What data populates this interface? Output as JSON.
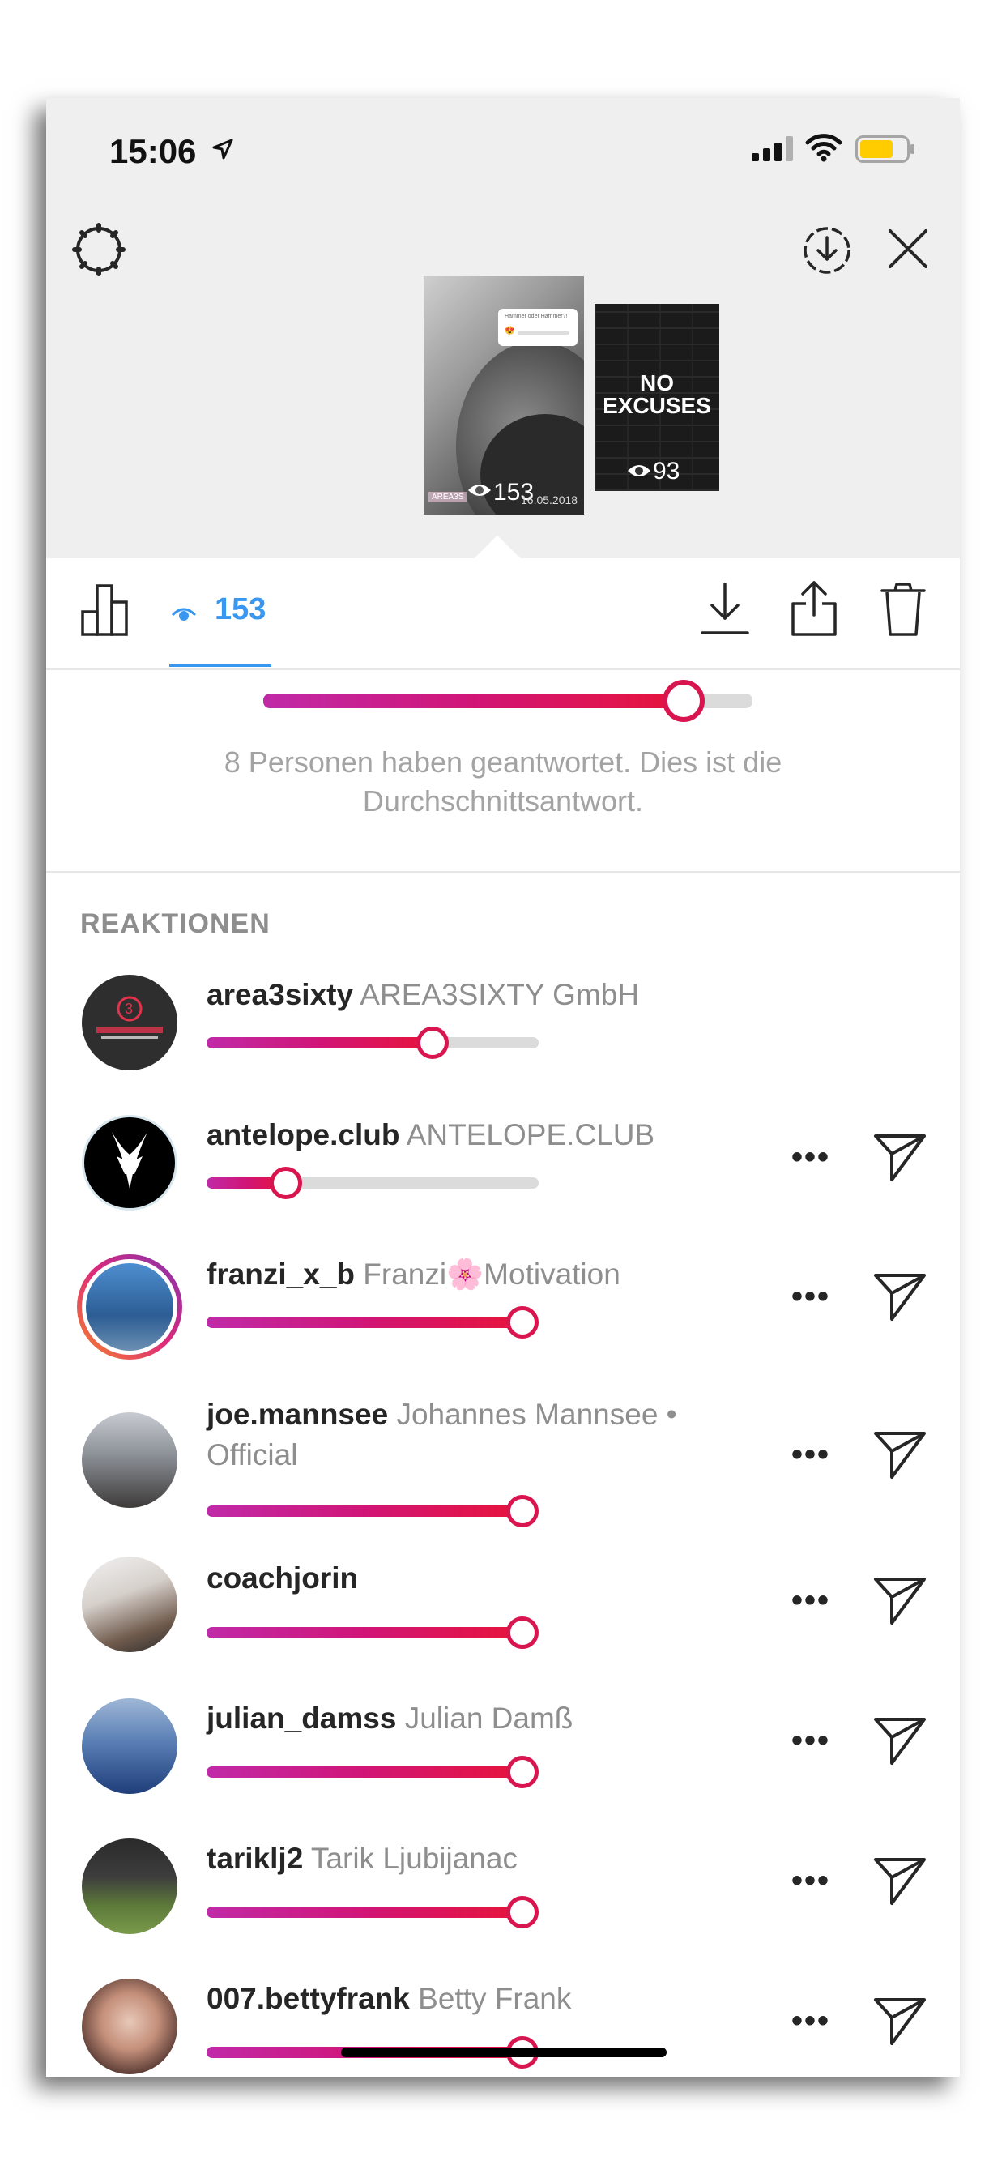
{
  "status": {
    "time": "15:06",
    "location_icon": "location-arrow-icon",
    "signal_icon": "cellular-signal-icon",
    "wifi_icon": "wifi-icon",
    "battery_icon": "battery-icon",
    "battery_color": "#ffcc00"
  },
  "header": {
    "settings_icon": "gear-icon",
    "download_icon": "circle-download-icon",
    "close_icon": "close-icon"
  },
  "stories": [
    {
      "view_count": "153",
      "brand": "AREA3S",
      "date": "16.05.2018",
      "sticker_text": "Hammer oder Hammer?!",
      "sticker_emoji": "😍",
      "eye_icon": "eye-icon"
    },
    {
      "title": "NO EXCUSES",
      "view_count": "93",
      "eye_icon": "eye-icon"
    }
  ],
  "toolbar": {
    "chart_icon": "bar-chart-icon",
    "viewer_count": "153",
    "viewers_icon": "eye-icon",
    "download_icon": "download-icon",
    "share_icon": "share-icon",
    "delete_icon": "trash-icon",
    "active_color": "#3897f0"
  },
  "average_slider": {
    "value": 0.86
  },
  "summary": "8 Personen haben geantwortet. Dies ist die Durchschnittsantwort.",
  "reactions_title": "REAKTIONEN",
  "reactions": [
    {
      "username": "area3sixty",
      "fullname": "AREA3SIXTY GmbH",
      "value": 0.68,
      "has_actions": false
    },
    {
      "username": "antelope.club",
      "fullname": "ANTELOPE.CLUB",
      "value": 0.24,
      "has_actions": true
    },
    {
      "username": "franzi_x_b",
      "fullname": "Franzi🌸Motivation",
      "value": 0.95,
      "has_actions": true
    },
    {
      "username": "joe.mannsee",
      "fullname": "Johannes Mannsee • Official",
      "value": 0.95,
      "has_actions": true
    },
    {
      "username": "coachjorin",
      "fullname": "",
      "value": 0.95,
      "has_actions": true
    },
    {
      "username": "julian_damss",
      "fullname": "Julian Damß",
      "value": 0.95,
      "has_actions": true
    },
    {
      "username": "tariklj2",
      "fullname": "Tarik Ljubijanac",
      "value": 0.95,
      "has_actions": true
    },
    {
      "username": "007.bettyfrank",
      "fullname": "Betty Frank",
      "value": 0.95,
      "has_actions": true
    }
  ],
  "row_actions": {
    "more_label": "•••",
    "more_icon": "more-icon",
    "send_icon": "send-icon"
  }
}
